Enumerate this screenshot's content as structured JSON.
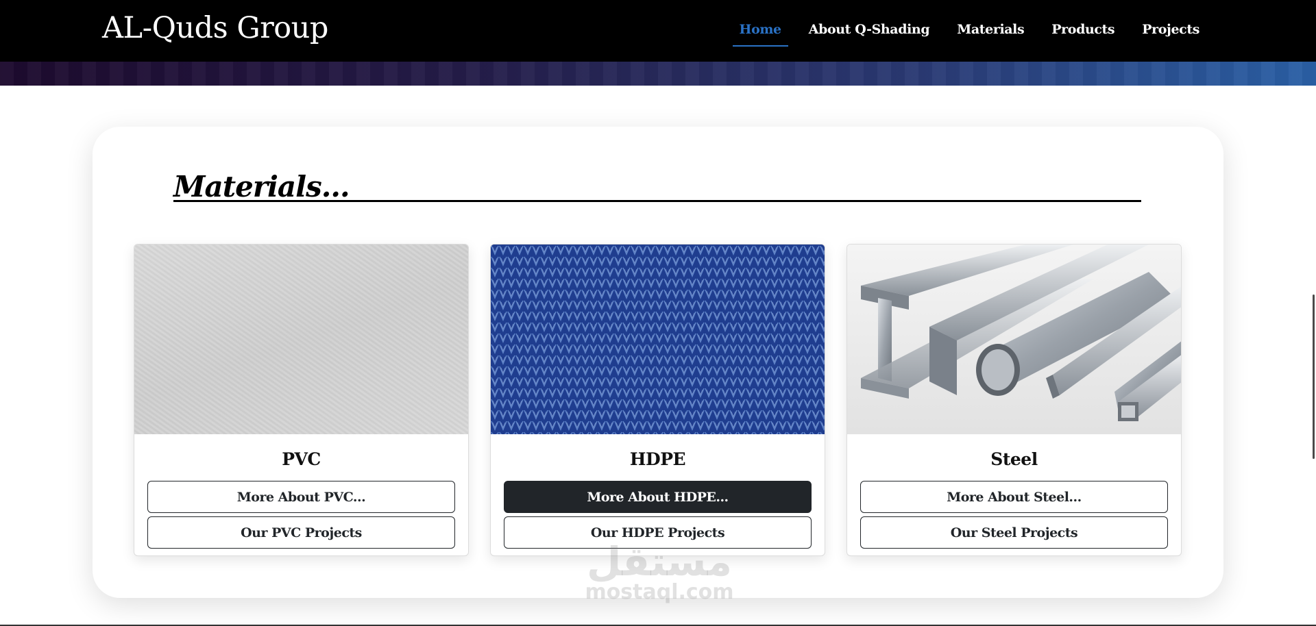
{
  "nav": {
    "brand": "AL-Quds Group",
    "links": [
      {
        "label": "Home",
        "active": true
      },
      {
        "label": "About Q-Shading",
        "active": false
      },
      {
        "label": "Materials",
        "active": false
      },
      {
        "label": "Products",
        "active": false
      },
      {
        "label": "Projects",
        "active": false
      }
    ],
    "active_color": "#2a72c6"
  },
  "section": {
    "title": "Materials..."
  },
  "cards": [
    {
      "title": "PVC",
      "more_label": "More About PVC...",
      "projects_label": "Our PVC Projects",
      "image": "pvc-texture"
    },
    {
      "title": "HDPE",
      "more_label": "More About HDPE...",
      "projects_label": "Our HDPE Projects",
      "image": "hdpe-mesh"
    },
    {
      "title": "Steel",
      "more_label": "More About Steel...",
      "projects_label": "Our Steel Projects",
      "image": "steel-profiles"
    }
  ],
  "watermark": {
    "arabic": "مستقل",
    "latin": "mostaql.com"
  }
}
